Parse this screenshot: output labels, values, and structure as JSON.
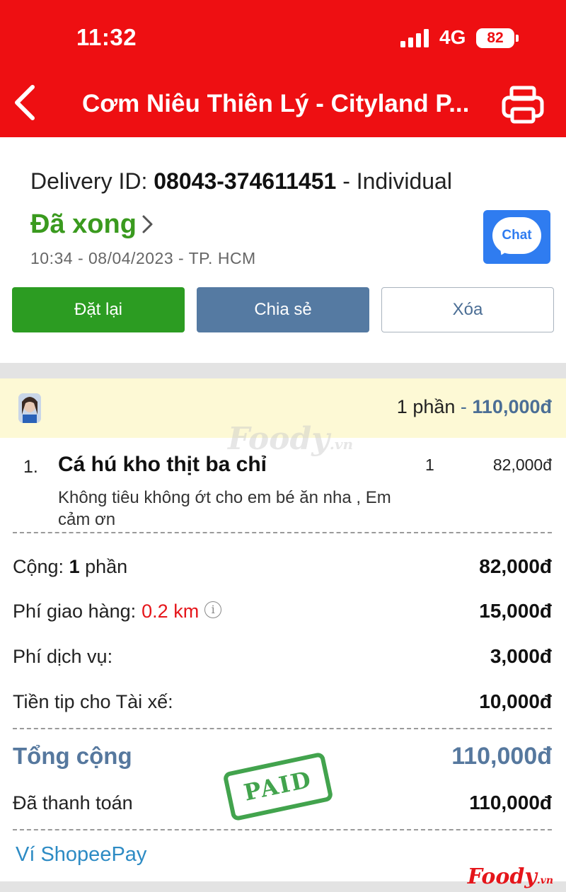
{
  "status_bar": {
    "time": "11:32",
    "network": "4G",
    "battery": "82"
  },
  "header": {
    "title": "Cơm Niêu Thiên Lý - Cityland P..."
  },
  "order": {
    "delivery_label": "Delivery ID: ",
    "delivery_id": "08043-374611451",
    "delivery_suffix": " - Individual",
    "status": "Đã xong",
    "meta": "10:34 - 08/04/2023 - TP. HCM",
    "chat_label": "Chat"
  },
  "actions": {
    "reorder": "Đặt lại",
    "share": "Chia sẻ",
    "delete": "Xóa"
  },
  "summary": {
    "portions": "1 phần",
    "separator": " - ",
    "amount": "110,000đ"
  },
  "watermark": {
    "name": "Foody",
    "suffix": ".vn"
  },
  "items": [
    {
      "index": "1.",
      "name": "Cá hú kho thịt ba chỉ",
      "qty": "1",
      "price": "82,000đ",
      "note": "Không tiêu không ớt cho em bé ăn nha , Em cảm ơn"
    }
  ],
  "totals": {
    "subtotal_label": "Cộng:",
    "subtotal_count": "1",
    "subtotal_unit": "phần",
    "subtotal_value": "82,000đ",
    "delivery_fee_label": "Phí giao hàng:",
    "distance": "0.2 km",
    "delivery_fee_value": "15,000đ",
    "service_fee_label": "Phí dịch vụ:",
    "service_fee_value": "3,000đ",
    "tip_label": "Tiền tip cho Tài xế:",
    "tip_value": "10,000đ",
    "total_label": "Tổng cộng",
    "total_value": "110,000đ",
    "paid_label": "Đã thanh toán",
    "paid_value": "110,000đ"
  },
  "stamp": "PAID",
  "payment_method": "Ví ShopeePay",
  "brand": {
    "name": "Foody",
    "suffix": ".vn"
  },
  "colors": {
    "header": "#ee0f12",
    "status_done": "#3a9a1e",
    "accent_blue": "#4b6e95",
    "distance_red": "#e5161b",
    "paid_green": "#2e9a3a"
  }
}
